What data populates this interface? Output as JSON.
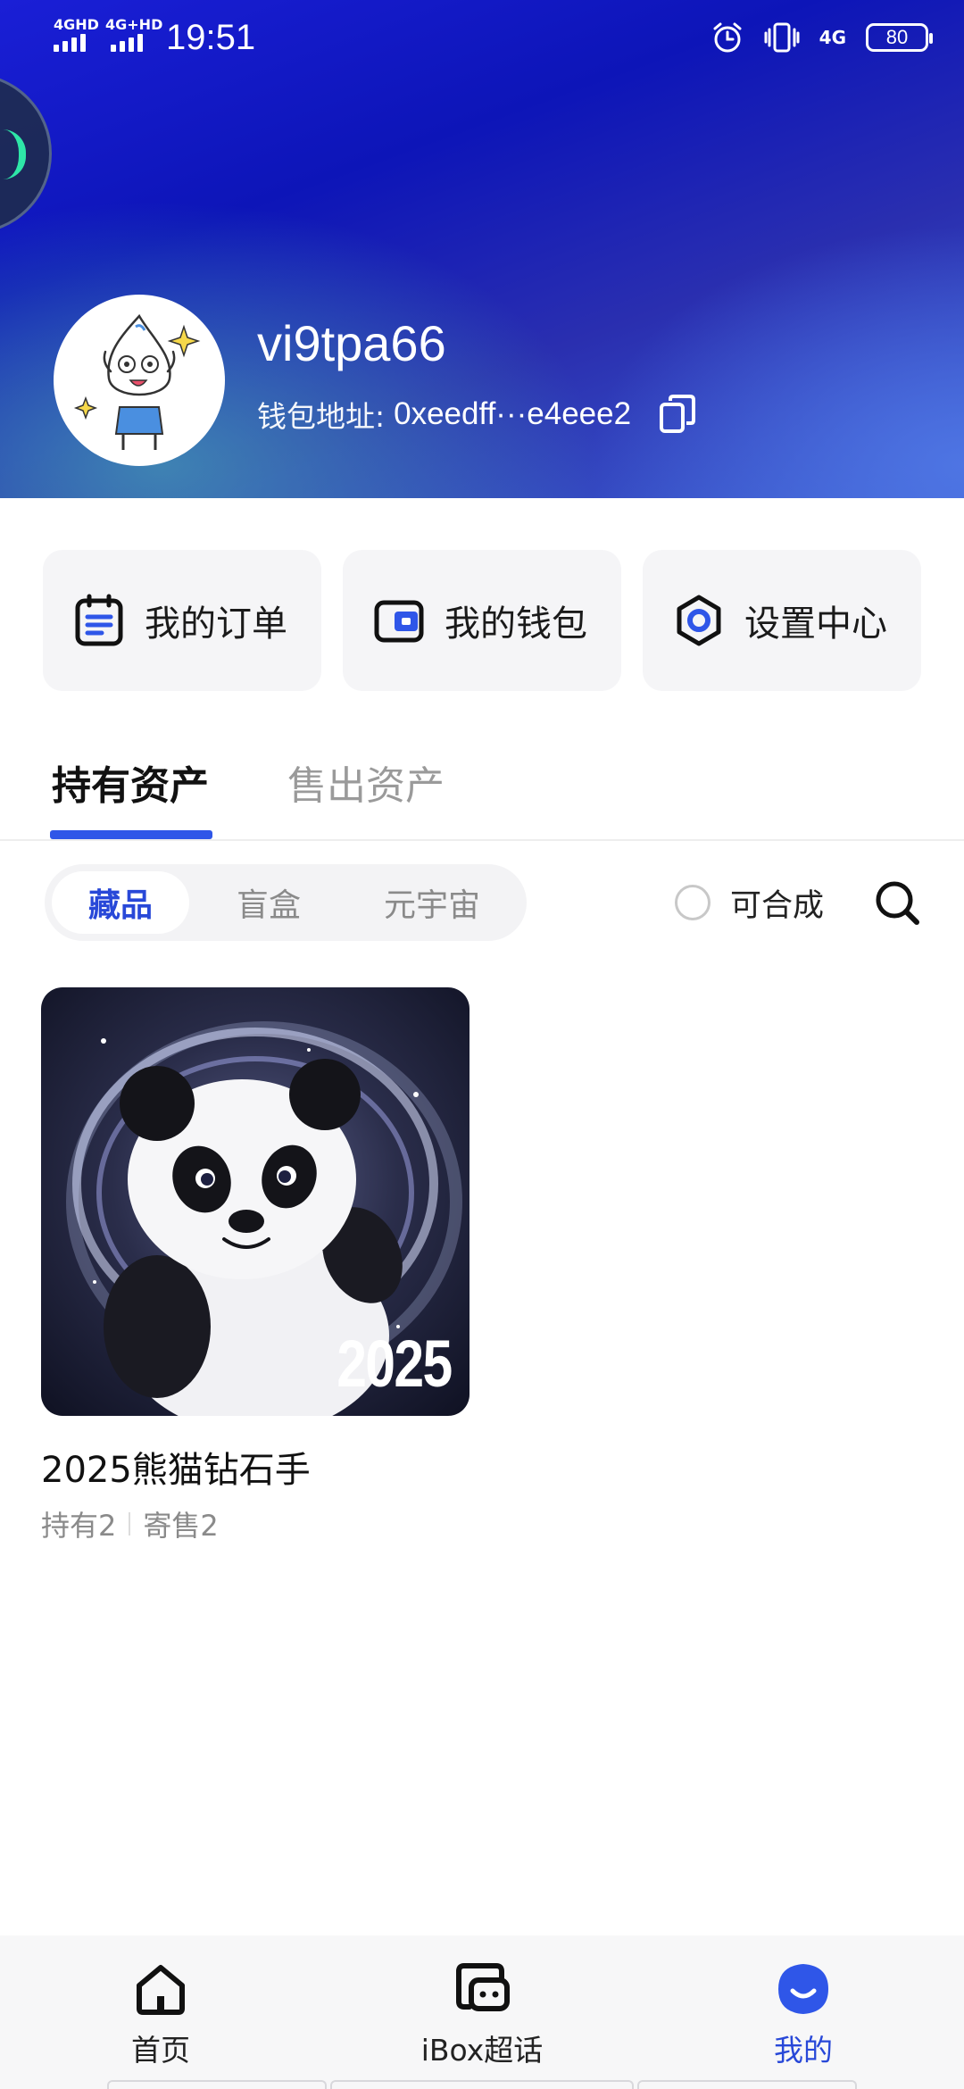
{
  "status_bar": {
    "network_1": "4GHD",
    "network_2": "4G+HD",
    "time": "19:51",
    "mobile_data": "4G",
    "battery": "80"
  },
  "profile": {
    "username": "vi9tpa66",
    "wallet_label": "钱包地址:",
    "wallet_address": "0xeedff···e4eee2"
  },
  "actions": [
    {
      "label": "我的订单",
      "icon": "order-icon"
    },
    {
      "label": "我的钱包",
      "icon": "wallet-icon"
    },
    {
      "label": "设置中心",
      "icon": "settings-icon"
    }
  ],
  "tabs": [
    {
      "label": "持有资产",
      "active": true
    },
    {
      "label": "售出资产",
      "active": false
    }
  ],
  "filters": {
    "segments": [
      {
        "label": "藏品",
        "active": true
      },
      {
        "label": "盲盒",
        "active": false
      },
      {
        "label": "元宇宙",
        "active": false
      }
    ],
    "merge_label": "可合成",
    "merge_checked": false
  },
  "assets": [
    {
      "image_text": "2025",
      "name": "2025熊猫钻石手",
      "held": "持有2",
      "consigned": "寄售2"
    }
  ],
  "bottom_nav": [
    {
      "label": "首页",
      "icon": "home-icon",
      "active": false
    },
    {
      "label": "iBox超话",
      "icon": "chat-icon",
      "active": false
    },
    {
      "label": "我的",
      "icon": "profile-icon",
      "active": true
    }
  ],
  "colors": {
    "accent": "#2848d8",
    "tab_indicator": "#2f56e8",
    "header_gradient_start": "#1a1fd6",
    "header_gradient_end": "#3d5fd0"
  }
}
